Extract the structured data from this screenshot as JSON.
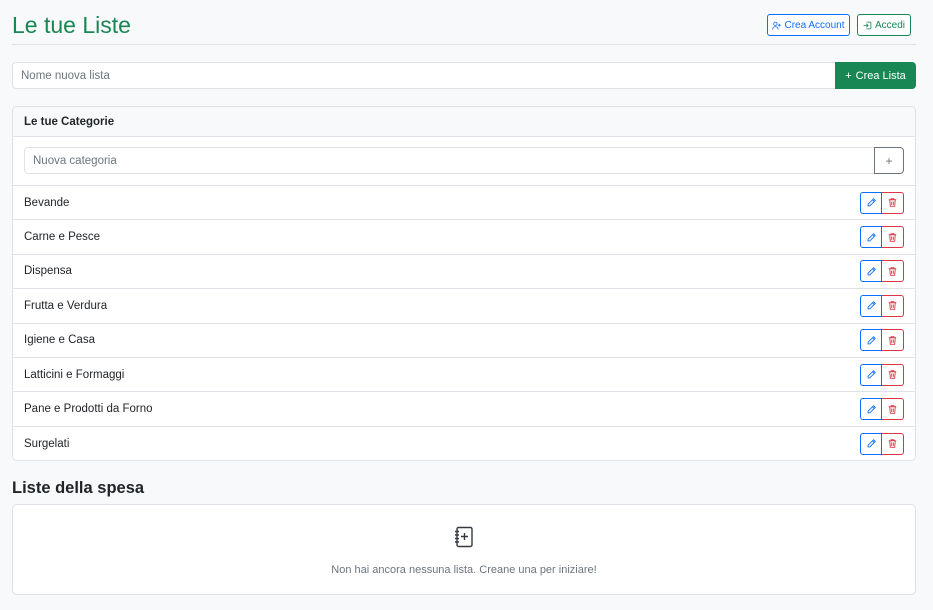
{
  "header": {
    "title": "Le tue Liste",
    "create_account_label": "Crea Account",
    "login_label": "Accedi"
  },
  "new_list": {
    "placeholder": "Nome nuova lista",
    "button_label": "Crea Lista"
  },
  "categories": {
    "title": "Le tue Categorie",
    "input_placeholder": "Nuova categoria",
    "add_button_label": "+",
    "items": [
      "Bevande",
      "Carne e Pesce",
      "Dispensa",
      "Frutta e Verdura",
      "Igiene e Casa",
      "Latticini e Formaggi",
      "Pane e Prodotti da Forno",
      "Surgelati"
    ]
  },
  "lists": {
    "title": "Liste della spesa",
    "empty_message": "Non hai ancora nessuna lista. Creane una per iniziare!"
  },
  "colors": {
    "primary_green": "#198754",
    "primary_blue": "#0d6efd",
    "danger_red": "#dc3545"
  }
}
